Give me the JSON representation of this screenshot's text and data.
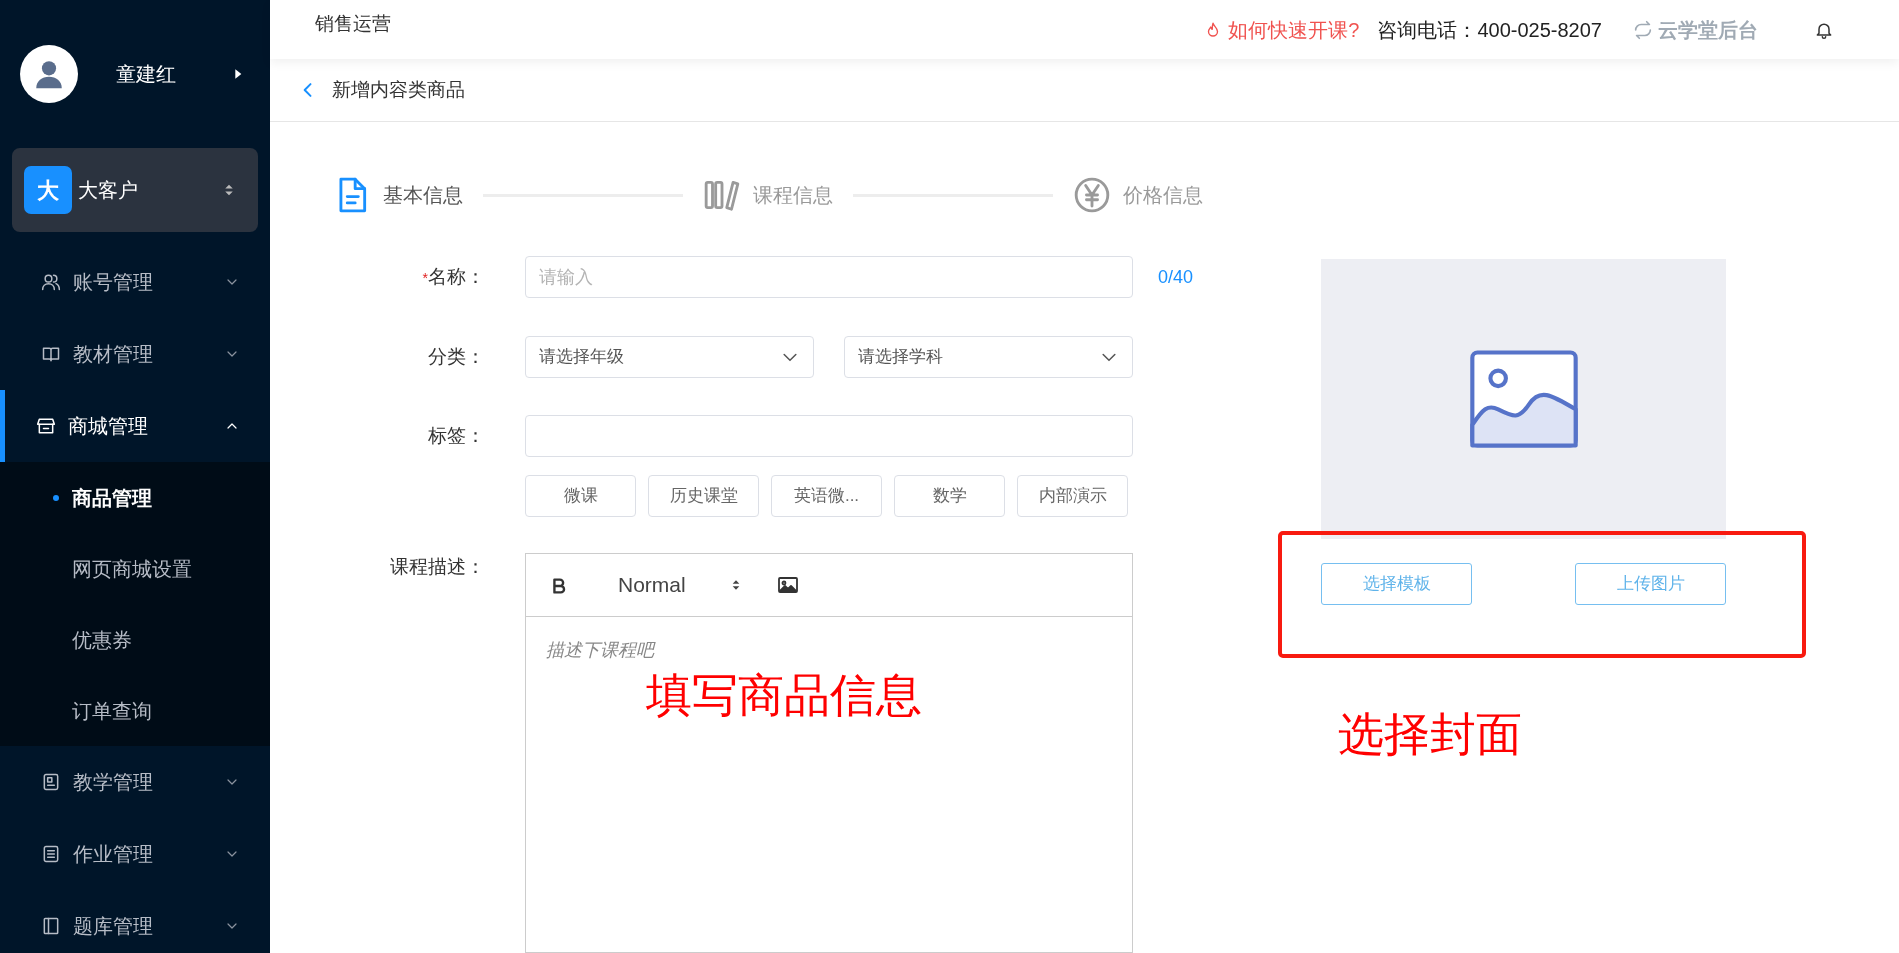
{
  "sidebar": {
    "user": {
      "name": "童建红"
    },
    "account": {
      "badge": "大",
      "name": "大客户"
    },
    "menu": [
      {
        "label": "账号管理",
        "kind": "people",
        "expanded": false,
        "selected": false
      },
      {
        "label": "教材管理",
        "kind": "book",
        "expanded": false,
        "selected": false
      },
      {
        "label": "商城管理",
        "kind": "shop",
        "expanded": true,
        "selected": true,
        "children": [
          {
            "label": "商品管理",
            "selected": true
          },
          {
            "label": "网页商城设置",
            "selected": false
          },
          {
            "label": "优惠券",
            "selected": false
          },
          {
            "label": "订单查询",
            "selected": false
          }
        ]
      },
      {
        "label": "教学管理",
        "kind": "board",
        "expanded": false,
        "selected": false
      },
      {
        "label": "作业管理",
        "kind": "list",
        "expanded": false,
        "selected": false
      },
      {
        "label": "题库管理",
        "kind": "bank",
        "expanded": false,
        "selected": false
      }
    ]
  },
  "header": {
    "title": "销售运营",
    "help_link": "如何快速开课?",
    "phone": "咨询电话：400-025-8207",
    "brand": "云学堂后台"
  },
  "page": {
    "title": "新增内容类商品"
  },
  "steps": [
    {
      "label": "基本信息",
      "kind": "doc",
      "selected": true
    },
    {
      "label": "课程信息",
      "kind": "books",
      "selected": false
    },
    {
      "label": "价格信息",
      "kind": "yen",
      "selected": false
    }
  ],
  "form": {
    "name": {
      "label": "名称：",
      "required_mark": "*",
      "placeholder": "请输入",
      "counter": "0/40"
    },
    "category": {
      "label": "分类：",
      "selects": [
        "请选择年级",
        "请选择学科"
      ]
    },
    "tags": {
      "label": "标签：",
      "chips": [
        "微课",
        "历史课堂",
        "英语微...",
        "数学",
        "内部演示"
      ]
    },
    "description": {
      "label": "课程描述：",
      "format": "Normal",
      "placeholder": "描述下课程吧"
    }
  },
  "cover": {
    "buttons": [
      "选择模板",
      "上传图片"
    ]
  },
  "annotations": [
    {
      "text": "填写商品信息"
    },
    {
      "text": "选择封面"
    }
  ]
}
